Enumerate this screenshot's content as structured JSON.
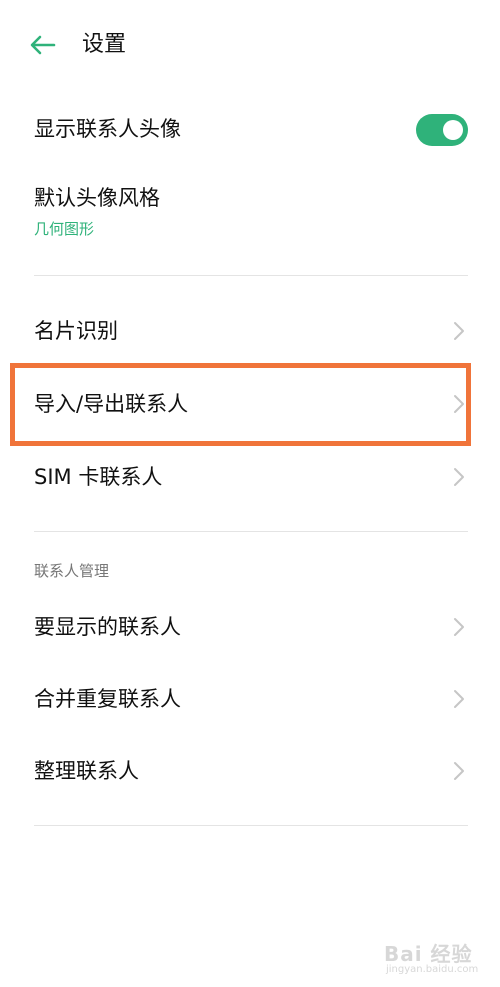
{
  "header": {
    "title": "设置",
    "back_icon": "arrow-left-icon",
    "accent_color": "#2fb27a"
  },
  "display_section": {
    "show_avatar": {
      "label": "显示联系人头像",
      "toggle_on": true
    },
    "default_avatar_style": {
      "label": "默认头像风格",
      "value": "几何图形"
    }
  },
  "tools_section": {
    "items": [
      {
        "label": "名片识别",
        "icon": "chevron-right-icon"
      },
      {
        "label": "导入/导出联系人",
        "icon": "chevron-right-icon",
        "highlighted": true
      },
      {
        "label": "SIM 卡联系人",
        "icon": "chevron-right-icon"
      }
    ]
  },
  "management_section": {
    "title": "联系人管理",
    "items": [
      {
        "label": "要显示的联系人",
        "icon": "chevron-right-icon"
      },
      {
        "label": "合并重复联系人",
        "icon": "chevron-right-icon"
      },
      {
        "label": "整理联系人",
        "icon": "chevron-right-icon"
      }
    ]
  },
  "annotation": {
    "highlight_color": "#f0743a"
  },
  "watermark": {
    "text": "Bai 经验",
    "subtext": "jingyan.baidu.com"
  }
}
